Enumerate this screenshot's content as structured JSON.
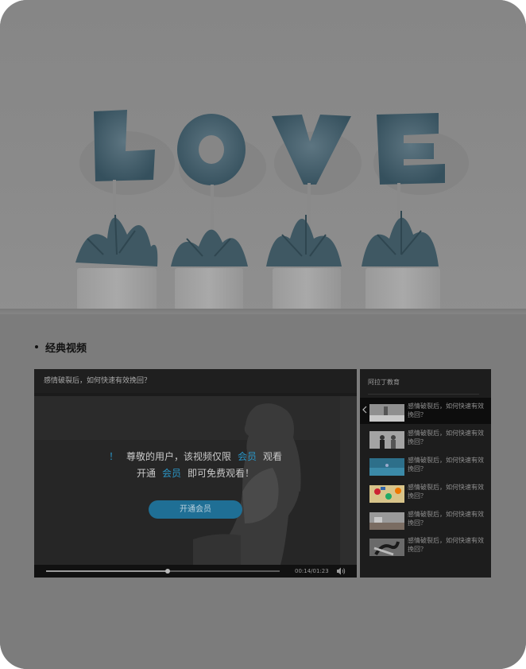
{
  "hero": {
    "word": "LOVE"
  },
  "section": {
    "title": "经典视频"
  },
  "player": {
    "title": "感情破裂后，如何快速有效挽回？",
    "notice": {
      "mark": "！",
      "line1_pre": "尊敬的用户，该视频仅限",
      "line1_vip": "会员",
      "line1_post": "观看",
      "line2_pre": "开通",
      "line2_vip": "会员",
      "line2_post": "即可免费观看！"
    },
    "open_button": "开通会员",
    "time": "00:14/01:23",
    "progress": 0.52,
    "accent_color": "#2a95c6"
  },
  "playlist": {
    "header": "阿拉丁教育",
    "items": [
      {
        "text": "感情破裂后，如何快速有效挽回？",
        "thumb": "gray-room-icon",
        "active": true
      },
      {
        "text": "感情破裂后，如何快速有效挽回？",
        "thumb": "couple-icon",
        "active": false
      },
      {
        "text": "感情破裂后，如何快速有效挽回？",
        "thumb": "teal-scene-icon",
        "active": false
      },
      {
        "text": "感情破裂后，如何快速有效挽回？",
        "thumb": "colorful-items-icon",
        "active": false
      },
      {
        "text": "感情破裂后，如何快速有效挽回？",
        "thumb": "room-icon",
        "active": false
      },
      {
        "text": "感情破裂后，如何快速有效挽回？",
        "thumb": "hands-icon",
        "active": false
      }
    ]
  }
}
